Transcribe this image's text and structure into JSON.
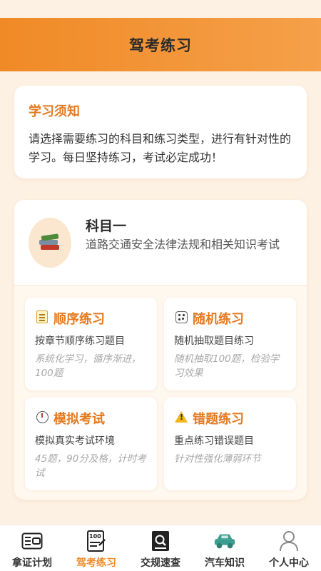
{
  "header": {
    "title": "驾考练习"
  },
  "notice": {
    "title": "学习须知",
    "text": "请选择需要练习的科目和练习类型，进行有针对性的学习。每日坚持练习，考试必定成功！"
  },
  "subject": {
    "name": "科目一",
    "description": "道路交通安全法律法规和相关知识考试",
    "icon": "books-icon"
  },
  "practice": [
    {
      "title": "顺序练习",
      "subtitle": "按章节顺序练习题目",
      "note": "系统化学习，循序渐进，100题",
      "icon": "memo-icon"
    },
    {
      "title": "随机练习",
      "subtitle": "随机抽取题目练习",
      "note": "随机抽取100题，检验学习效果",
      "icon": "dice-icon"
    },
    {
      "title": "模拟考试",
      "subtitle": "模拟真实考试环境",
      "note": "45题，90分及格，计时考试",
      "icon": "stopwatch-icon"
    },
    {
      "title": "错题练习",
      "subtitle": "重点练习错误题目",
      "note": "针对性强化薄弱环节",
      "icon": "warning-icon"
    }
  ],
  "tabs": [
    {
      "label": "拿证计划",
      "icon": "license-card-icon",
      "active": false
    },
    {
      "label": "驾考练习",
      "icon": "exam-paper-icon",
      "active": true
    },
    {
      "label": "交规速查",
      "icon": "search-book-icon",
      "active": false
    },
    {
      "label": "汽车知识",
      "icon": "car-icon",
      "active": false
    },
    {
      "label": "个人中心",
      "icon": "user-icon",
      "active": false
    }
  ],
  "colors": {
    "accent": "#f08a26",
    "background": "#fdf1e3",
    "car_icon": "#3a9e8f"
  }
}
